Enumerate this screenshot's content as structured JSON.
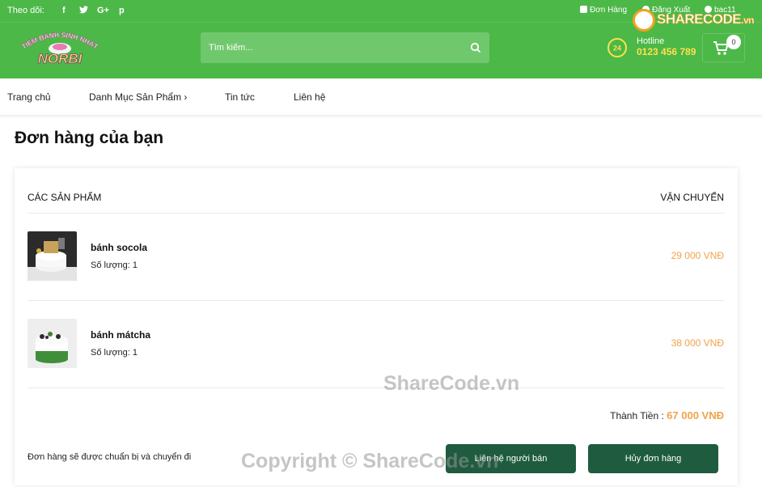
{
  "colors": {
    "header_green": "#4cb848",
    "accent_orange": "#f0a34a",
    "button_dark_green": "#1f5c3f",
    "hotline_yellow": "#ffe14d"
  },
  "topbar": {
    "follow_label": "Theo dõi:",
    "social_icons": [
      "facebook-icon",
      "twitter-icon",
      "google-plus-icon",
      "pinterest-icon"
    ],
    "social_glyphs": [
      "f",
      "y",
      "G+",
      "p"
    ],
    "links": {
      "orders": "Đơn Hàng",
      "logout": "Đăng Xuất",
      "user": "bac11"
    }
  },
  "logo": {
    "line1": "TIỆM BÁNH SINH NHẬT",
    "line2": "NORBI"
  },
  "search": {
    "placeholder": "Tìm kiếm..."
  },
  "hotline": {
    "label": "Hotline",
    "number": "0123 456 789",
    "badge": "24"
  },
  "cart": {
    "count": "0"
  },
  "brand_watermark": {
    "text": "SHARECODE",
    "suffix": ".vn"
  },
  "nav": {
    "items": [
      "Trang chủ",
      "Danh Mục Sản Phẩm ›",
      "Tin tức",
      "Liên hệ"
    ]
  },
  "page_title": "Đơn hàng của bạn",
  "order": {
    "col_products": "CÁC SẢN PHẨM",
    "col_shipping": "VẬN CHUYỂN",
    "items": [
      {
        "name": "bánh socola",
        "qty": "Số lượng: 1",
        "price": "29 000 VNĐ"
      },
      {
        "name": "bánh mátcha",
        "qty": "Số lượng: 1",
        "price": "38 000 VNĐ"
      }
    ],
    "total_label": "Thành Tiền :",
    "total_value": "67 000 VNĐ",
    "note": "Đơn hàng sẽ được chuẩn bị và chuyển đi",
    "contact_button": "Liên hệ người bán",
    "cancel_button": "Hủy đơn hàng"
  },
  "watermarks": {
    "sharecode": "ShareCode.vn",
    "copyright": "Copyright © ShareCode.vn"
  }
}
